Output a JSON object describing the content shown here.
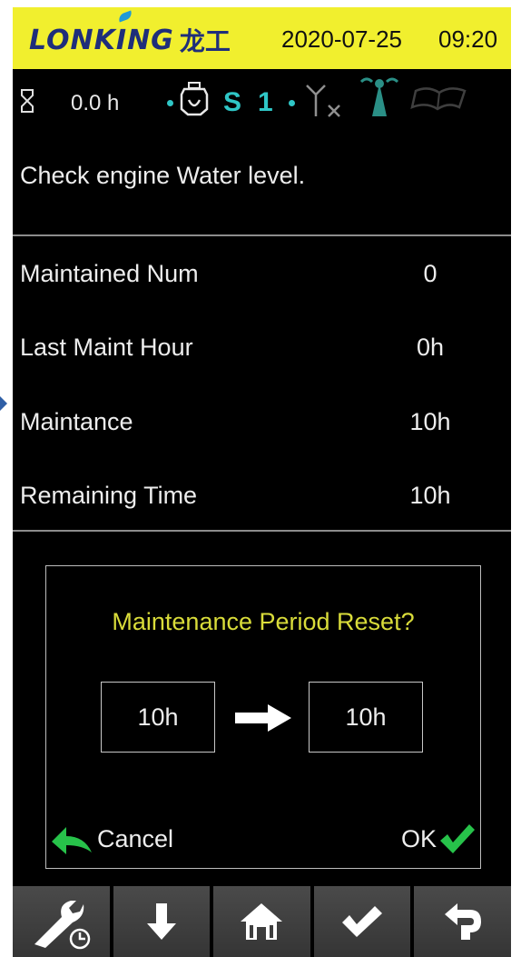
{
  "header": {
    "brand_name": "LONKING",
    "brand_cn": "龙工",
    "date": "2020-07-25",
    "time": "09:20",
    "background": "#f1ef2e",
    "brand_color": "#1f2e7a"
  },
  "status": {
    "hours": "0.0 h",
    "s_label": "S",
    "s_value": "1",
    "accent": "#2fc6c6",
    "icons": [
      "hourglass-icon",
      "engine-icon",
      "antenna-no-signal-icon",
      "signal-tower-icon",
      "manual-book-icon"
    ]
  },
  "message": "Check engine Water level.",
  "rows": [
    {
      "label": "Maintained Num",
      "value": "0"
    },
    {
      "label": "Last Maint Hour",
      "value": "0h"
    },
    {
      "label": "Maintance",
      "value": "10h"
    },
    {
      "label": "Remaining Time",
      "value": "10h"
    }
  ],
  "dialog": {
    "title": "Maintenance Period Reset?",
    "from_value": "10h",
    "to_value": "10h",
    "cancel_label": "Cancel",
    "ok_label": "OK",
    "title_color": "#d9dc3a",
    "confirm_color": "#27c24a"
  },
  "toolbar": {
    "buttons": [
      "wrench-clock-icon",
      "down-arrow-icon",
      "home-icon",
      "check-icon",
      "back-icon"
    ]
  }
}
